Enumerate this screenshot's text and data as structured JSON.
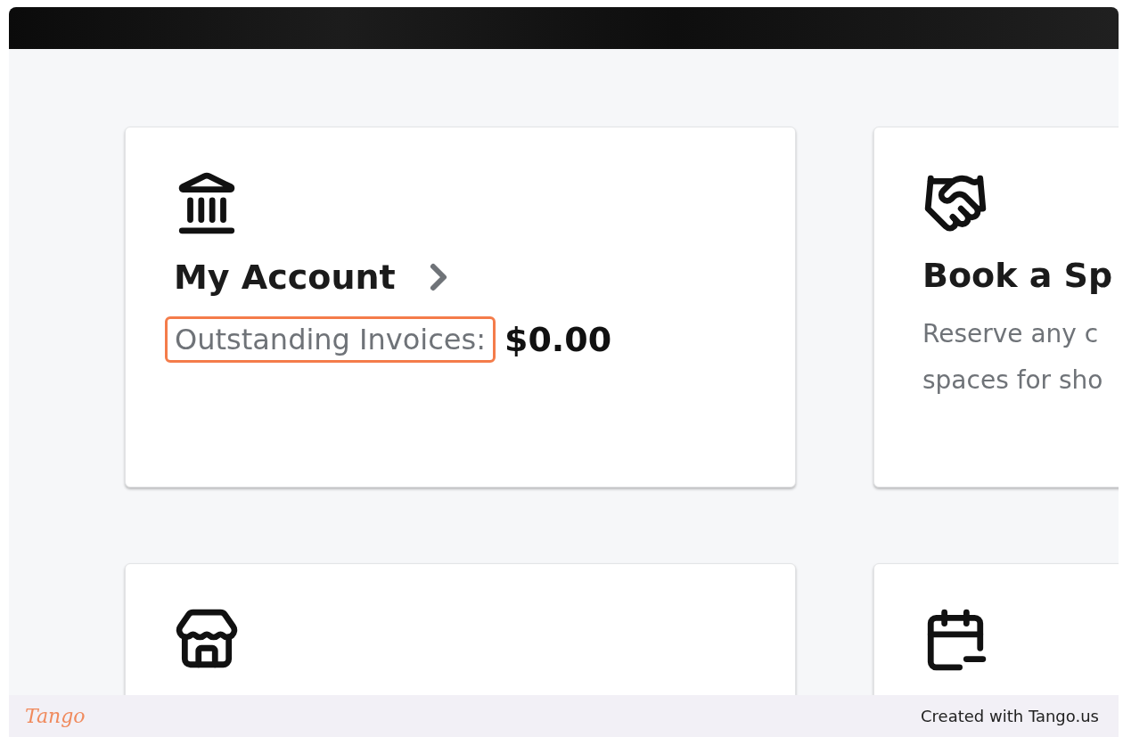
{
  "cards": [
    {
      "kind": "account",
      "title": "My Account",
      "label": "Outstanding Invoices:",
      "label_highlighted": true,
      "value": "$0.00"
    },
    {
      "kind": "info",
      "title": "Book a Sp",
      "lines": [
        "Reserve any c",
        "spaces for sho"
      ]
    },
    {
      "kind": "icon_only"
    },
    {
      "kind": "icon_only"
    }
  ],
  "footer": {
    "logo": "Tango",
    "credit": "Created with Tango.us"
  }
}
